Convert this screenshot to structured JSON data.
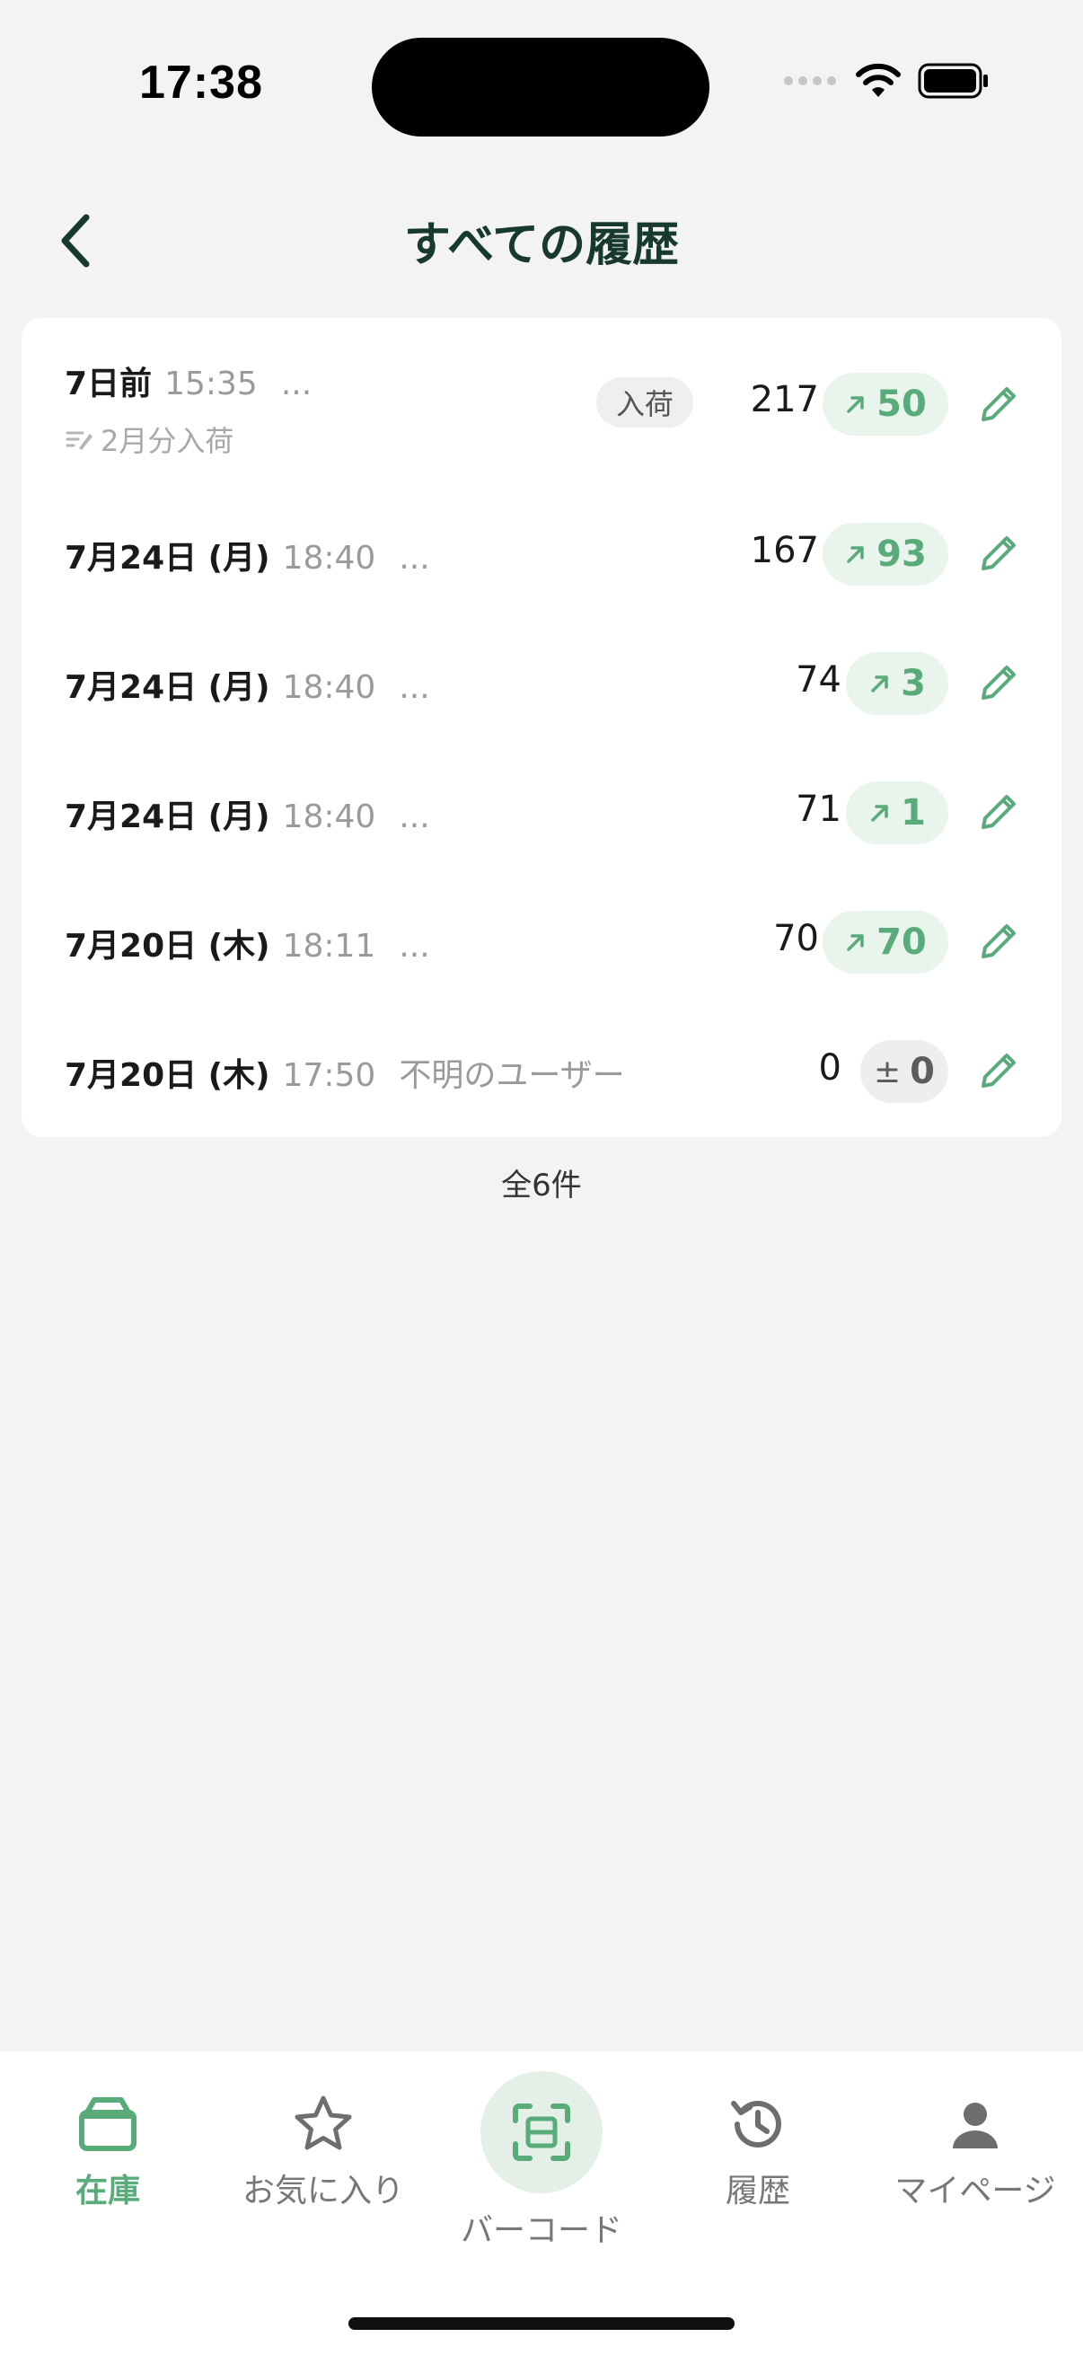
{
  "status": {
    "time": "17:38"
  },
  "header": {
    "title": "すべての履歴"
  },
  "history": [
    {
      "date": "7日前",
      "time": "15:35",
      "user": "...",
      "memo": "2月分入荷",
      "tag": "入荷",
      "quantity": "217",
      "change": "50",
      "direction": "up"
    },
    {
      "date": "7月24日 (月)",
      "time": "18:40",
      "user": "...",
      "quantity": "167",
      "change": "93",
      "direction": "up"
    },
    {
      "date": "7月24日 (月)",
      "time": "18:40",
      "user": "...",
      "quantity": "74",
      "change": "3",
      "direction": "up"
    },
    {
      "date": "7月24日 (月)",
      "time": "18:40",
      "user": "...",
      "quantity": "71",
      "change": "1",
      "direction": "up"
    },
    {
      "date": "7月20日 (木)",
      "time": "18:11",
      "user": "...",
      "quantity": "70",
      "change": "70",
      "direction": "up"
    },
    {
      "date": "7月20日 (木)",
      "time": "17:50",
      "user": "不明のユーザー",
      "quantity": "0",
      "change": "0",
      "direction": "zero"
    }
  ],
  "total_label": "全6件",
  "tabs": [
    {
      "label": "在庫",
      "icon": "box-icon",
      "active": true
    },
    {
      "label": "お気に入り",
      "icon": "star-icon",
      "active": false
    },
    {
      "label": "バーコード",
      "icon": "barcode-scan-icon",
      "active": false
    },
    {
      "label": "履歴",
      "icon": "history-icon",
      "active": false
    },
    {
      "label": "マイページ",
      "icon": "person-icon",
      "active": false
    }
  ],
  "colors": {
    "accent": "#5aab7a",
    "accent_bg": "#e8f4ec",
    "title": "#173a2c",
    "background": "#f3f3f3"
  }
}
